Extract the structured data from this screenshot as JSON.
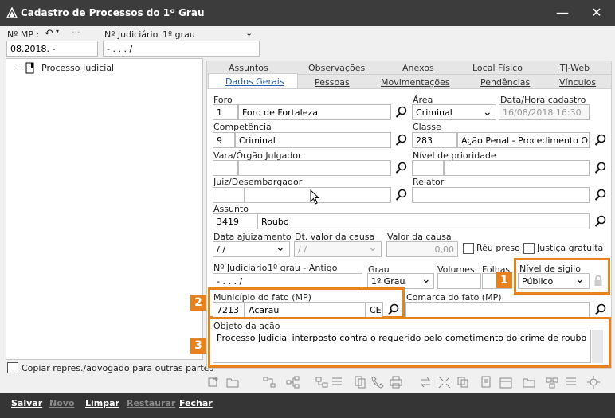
{
  "window": {
    "title": "Cadastro de Processos do 1º Grau",
    "minimize": "—",
    "close": "✕"
  },
  "topbar": {
    "mp_label": "Nº MP :",
    "mp_value": "08.2018.        -",
    "judiciario_label": "Nº Judiciário",
    "grau_label": "1º grau",
    "judiciario_value": "       -    .    .    .    /"
  },
  "tree": {
    "root_label": "Processo Judicial"
  },
  "copy_check_label": "Copiar repres./advogado para outras partes",
  "tabs_back": [
    "Assuntos",
    "Observações",
    "Anexos",
    "Local Físico",
    "TJ-Web"
  ],
  "tabs_front": [
    "Dados Gerais",
    "Pessoas",
    "Movimentações",
    "Pendências",
    "Vínculos"
  ],
  "form": {
    "foro_label": "Foro",
    "foro_code": "1",
    "foro_name": "Foro de Fortaleza",
    "area_label": "Área",
    "area_value": "Criminal",
    "data_cadastro_label": "Data/Hora cadastro",
    "data_cadastro_value": "16/08/2018 16:30",
    "competencia_label": "Competência",
    "competencia_code": "9",
    "competencia_name": "Criminal",
    "classe_label": "Classe",
    "classe_code": "283",
    "classe_name": "Ação Penal - Procedimento Ordi",
    "vara_label": "Vara/Órgão Julgador",
    "prioridade_label": "Nível de prioridade",
    "juiz_label": "Juiz/Desembargador",
    "relator_label": "Relator",
    "assunto_label": "Assunto",
    "assunto_code": "3419",
    "assunto_name": "Roubo",
    "data_ajuizamento_label": "Data ajuizamento",
    "data_ajuizamento_value": " / /",
    "dt_valor_label": "Dt. valor da causa",
    "dt_valor_value": " / /",
    "valor_label": "Valor da causa",
    "valor_value": "0,00",
    "reu_preso_label": "Réu preso",
    "justica_gratuita_label": "Justiça gratuita",
    "num_judiciario_label": "Nº Judiciário",
    "grau_antigo_label": "1º grau - Antigo",
    "num_judiciario_value": "       -    .    .    .    /",
    "grau_label": "Grau",
    "grau_value": "1º Grau",
    "volumes_label": "Volumes",
    "folhas_label": "Folhas",
    "sigilo_label": "Nível de sigilo",
    "sigilo_value": "Público",
    "municipio_label": "Município do fato (MP)",
    "municipio_code": "7213",
    "municipio_name": "Acarau",
    "municipio_uf": "CE",
    "comarca_label": "Comarca do fato (MP)",
    "objeto_label": "Objeto da ação",
    "objeto_value": "Processo Judicial interposto contra o requerido pelo cometimento do crime de roubo"
  },
  "callouts": [
    "1",
    "2",
    "3"
  ],
  "bottom_buttons": [
    "Salvar",
    "Novo",
    "Limpar",
    "Restaurar",
    "Fechar"
  ],
  "colors": {
    "callout": "#e8821e",
    "titlebar": "#3c3c3c",
    "bottombar": "#353535"
  }
}
